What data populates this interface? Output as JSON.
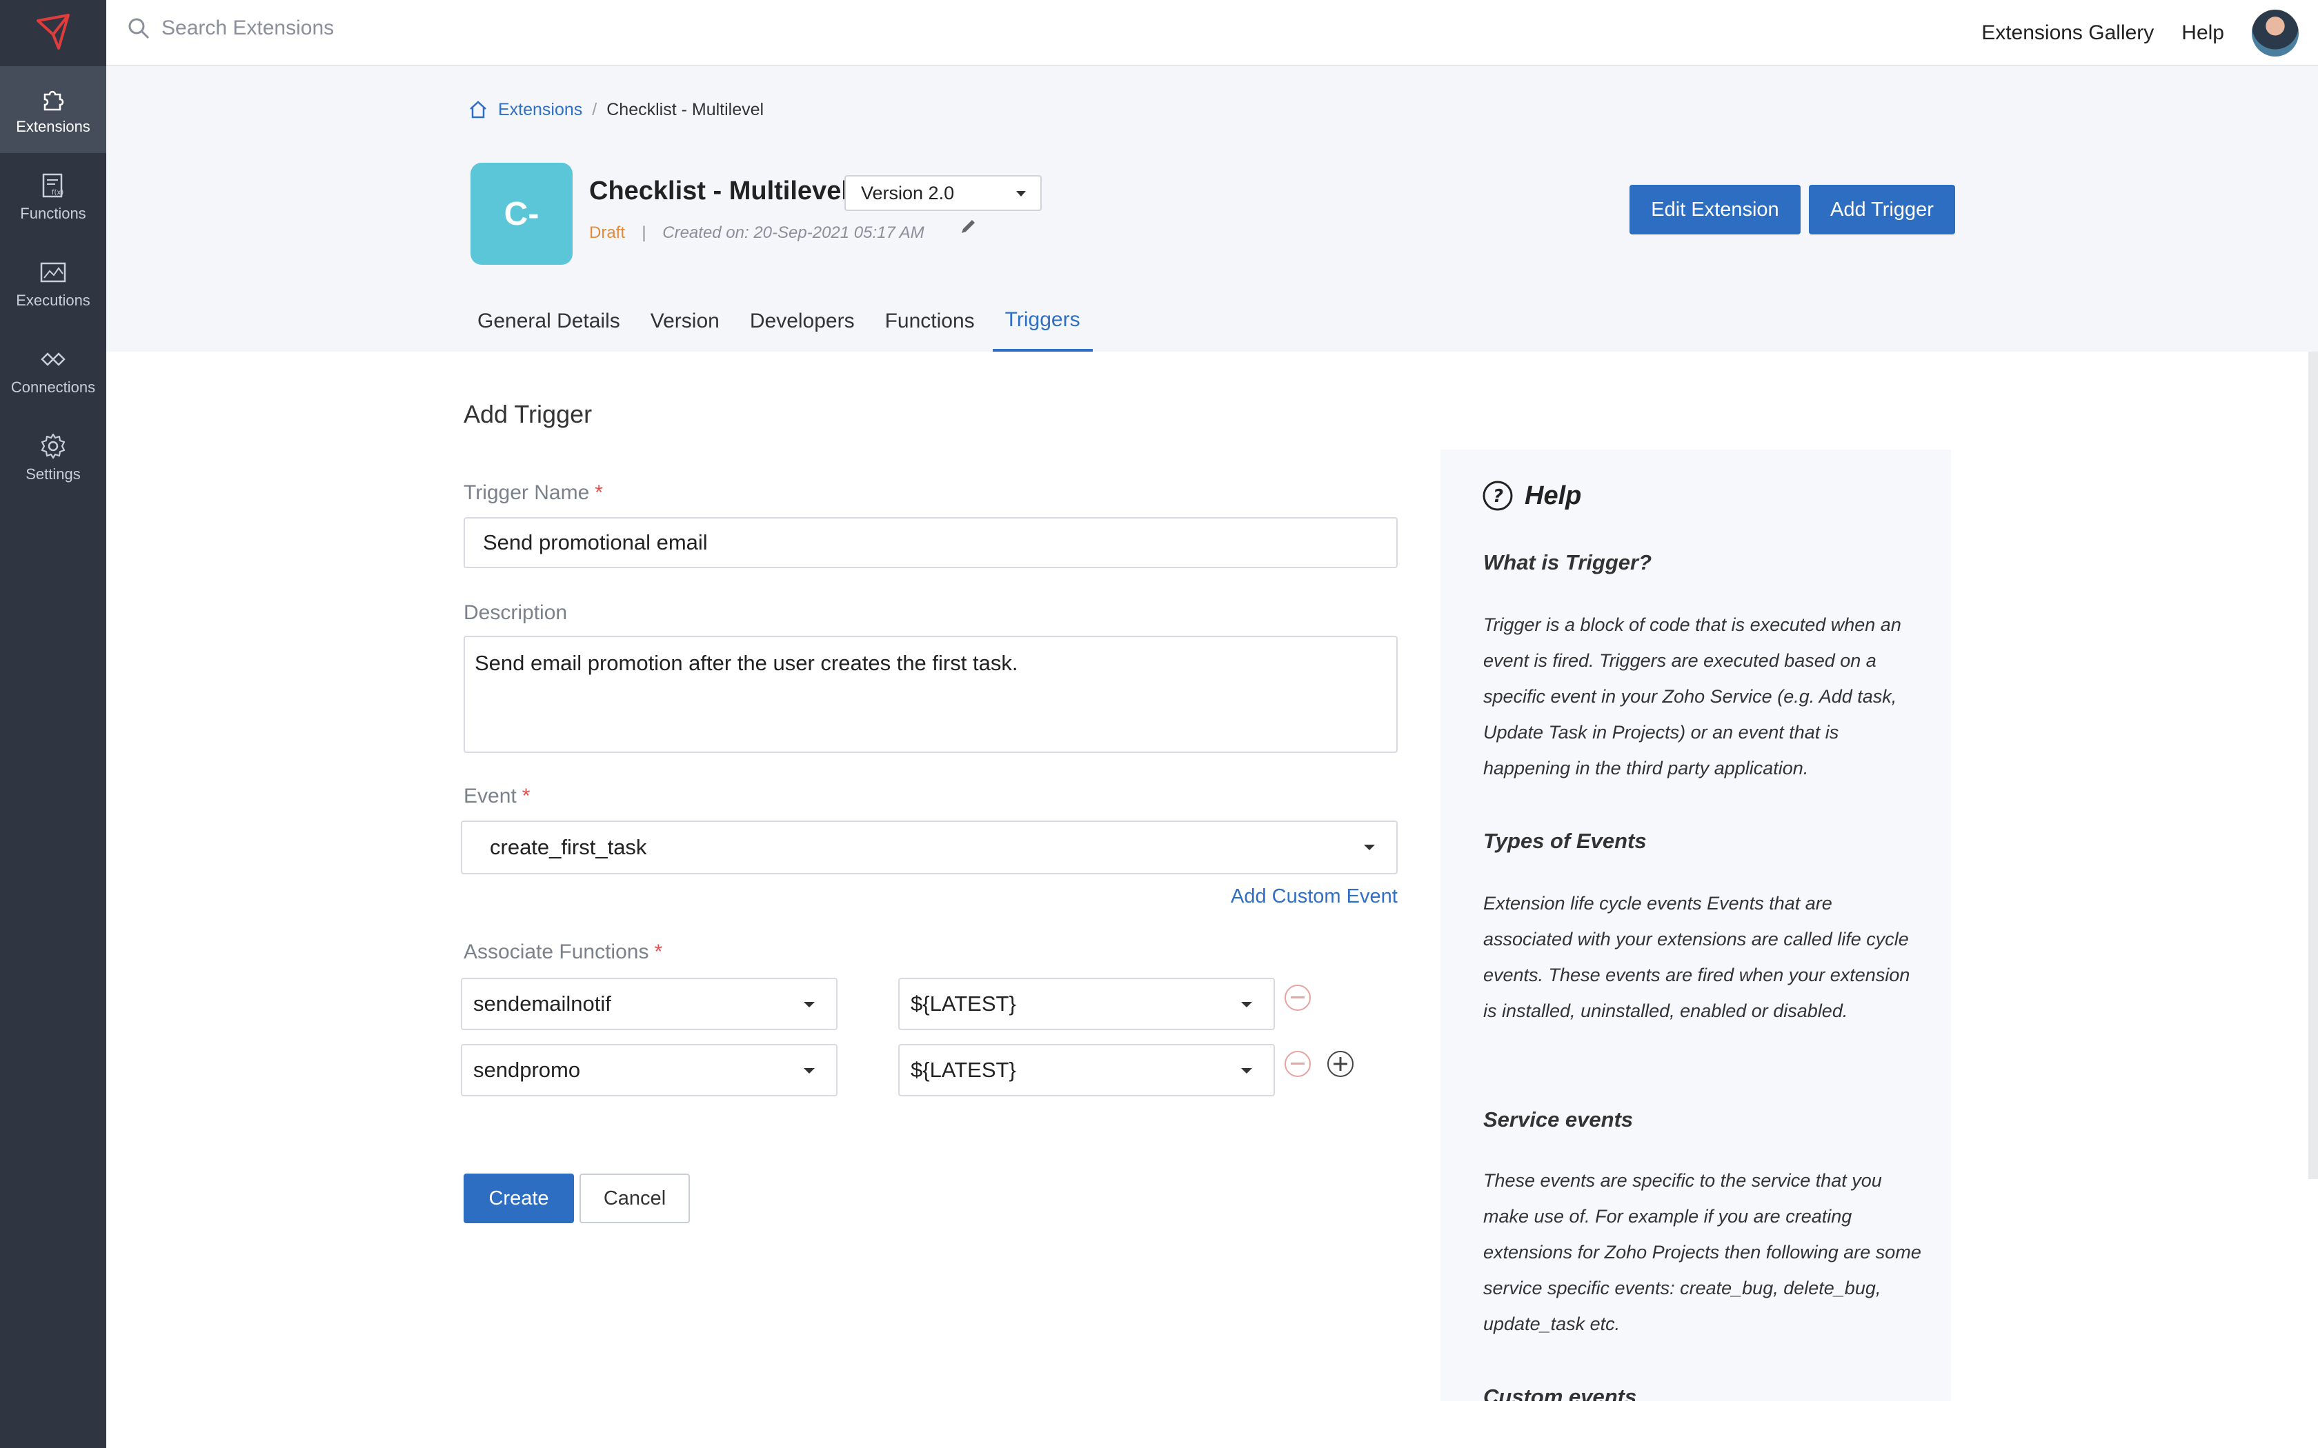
{
  "sidebar": {
    "items": [
      {
        "label": "Extensions",
        "icon": "puzzle-icon",
        "active": true
      },
      {
        "label": "Functions",
        "icon": "function-icon",
        "active": false
      },
      {
        "label": "Executions",
        "icon": "executions-icon",
        "active": false
      },
      {
        "label": "Connections",
        "icon": "connections-icon",
        "active": false
      },
      {
        "label": "Settings",
        "icon": "gear-icon",
        "active": false
      }
    ]
  },
  "topbar": {
    "search_placeholder": "Search Extensions",
    "gallery_link": "Extensions Gallery",
    "help_link": "Help"
  },
  "breadcrumb": {
    "root": "Extensions",
    "separator": "/",
    "current": "Checklist - Multilevel"
  },
  "extension": {
    "icon_text": "C-",
    "title": "Checklist - Multilevel",
    "version": "Version 2.0",
    "status": "Draft",
    "meta_separator": "|",
    "created": "Created on: 20-Sep-2021 05:17 AM"
  },
  "actions": {
    "edit": "Edit Extension",
    "add_trigger": "Add Trigger"
  },
  "tabs": [
    "General Details",
    "Version",
    "Developers",
    "Functions",
    "Triggers"
  ],
  "active_tab": "Triggers",
  "form": {
    "title": "Add Trigger",
    "trigger_name_label": "Trigger Name",
    "trigger_name_value": "Send promotional email",
    "required_mark": "*",
    "description_label": "Description",
    "description_value": "Send email promotion after the user creates the first task.",
    "event_label": "Event",
    "event_value": "create_first_task",
    "add_custom_event": "Add Custom Event",
    "associate_label": "Associate Functions",
    "functions": [
      {
        "name": "sendemailnotif",
        "version": "${LATEST}"
      },
      {
        "name": "sendpromo",
        "version": "${LATEST}"
      }
    ],
    "create": "Create",
    "cancel": "Cancel"
  },
  "help": {
    "title": "Help",
    "sections": [
      {
        "heading": "What is Trigger?",
        "body": "Trigger is a block of code that is executed when an event is fired. Triggers are executed based on a specific event in your Zoho Service (e.g. Add task, Update Task in Projects) or an event that is happening in the third party application."
      },
      {
        "heading": "Types of Events",
        "body": "Extension life cycle events Events that are associated with your extensions are called life cycle events. These events are fired when your extension is installed, uninstalled, enabled or disabled."
      },
      {
        "heading": "Service events",
        "body": "These events are specific to the service that you make use of. For example if you are creating extensions for Zoho Projects then following are some service specific events: create_bug, delete_bug, update_task etc."
      },
      {
        "heading": "Custom events",
        "body": ""
      }
    ]
  },
  "colors": {
    "sidebar": "#2f3541",
    "accent": "#2d6ec2",
    "extension_icon": "#5bc6d8",
    "draft": "#e58b3a",
    "required": "#e14f4f"
  }
}
